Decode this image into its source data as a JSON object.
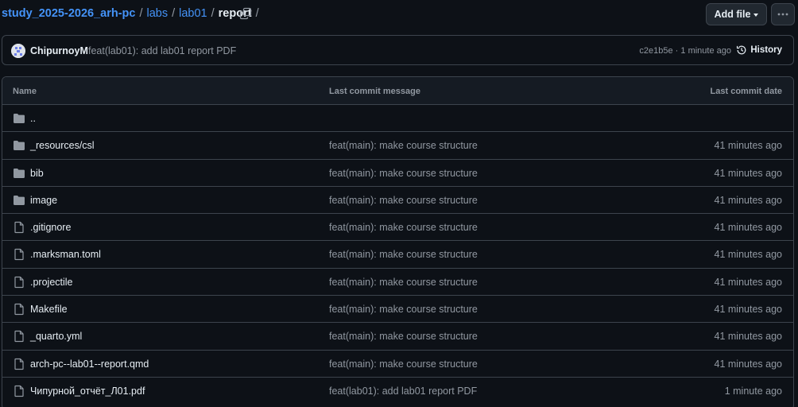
{
  "breadcrumb": {
    "repo": "study_2025-2026_arh-pc",
    "sep": "/",
    "path": [
      "labs",
      "lab01"
    ],
    "current": "report",
    "trailing_sep": "/"
  },
  "actions": {
    "add_file_label": "Add file"
  },
  "commit": {
    "author": "ChipurnoyM",
    "message": "feat(lab01): add lab01 report PDF",
    "hash": "c2e1b5e",
    "dot": "·",
    "time": "1 minute ago",
    "history_label": "History"
  },
  "table": {
    "headers": {
      "name": "Name",
      "message": "Last commit message",
      "date": "Last commit date"
    },
    "rows": [
      {
        "type": "folder",
        "name": "..",
        "message": "",
        "date": ""
      },
      {
        "type": "folder",
        "name": "_resources/csl",
        "message": "feat(main): make course structure",
        "date": "41 minutes ago"
      },
      {
        "type": "folder",
        "name": "bib",
        "message": "feat(main): make course structure",
        "date": "41 minutes ago"
      },
      {
        "type": "folder",
        "name": "image",
        "message": "feat(main): make course structure",
        "date": "41 minutes ago"
      },
      {
        "type": "file",
        "name": ".gitignore",
        "message": "feat(main): make course structure",
        "date": "41 minutes ago"
      },
      {
        "type": "file",
        "name": ".marksman.toml",
        "message": "feat(main): make course structure",
        "date": "41 minutes ago"
      },
      {
        "type": "file",
        "name": ".projectile",
        "message": "feat(main): make course structure",
        "date": "41 minutes ago"
      },
      {
        "type": "file",
        "name": "Makefile",
        "message": "feat(main): make course structure",
        "date": "41 minutes ago"
      },
      {
        "type": "file",
        "name": "_quarto.yml",
        "message": "feat(main): make course structure",
        "date": "41 minutes ago"
      },
      {
        "type": "file",
        "name": "arch-pc--lab01--report.qmd",
        "message": "feat(main): make course structure",
        "date": "41 minutes ago"
      },
      {
        "type": "file",
        "name": "Чипурной_отчёт_Л01.pdf",
        "message": "feat(lab01): add lab01 report PDF",
        "date": "1 minute ago"
      }
    ]
  },
  "colors": {
    "background": "#0d1117",
    "link": "#4493f8",
    "border": "#3d444d",
    "muted": "#9198a1",
    "header_bg": "#151b23"
  }
}
